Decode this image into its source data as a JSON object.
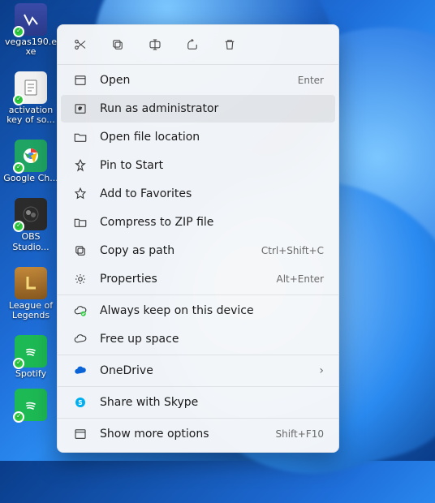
{
  "desktop": {
    "icons": [
      {
        "label": "vegas190.exe",
        "kind": "blue"
      },
      {
        "label": "activation key of so...",
        "kind": "white"
      },
      {
        "label": "Google Ch...",
        "kind": "green"
      },
      {
        "label": "OBS Studio...",
        "kind": "dark"
      },
      {
        "label": "League of Legends",
        "kind": "gold"
      },
      {
        "label": "Spotify",
        "kind": "spotify"
      }
    ]
  },
  "menu": {
    "toolbar": {
      "cut": "Cut",
      "copy": "Copy",
      "rename": "Rename",
      "share": "Share",
      "delete": "Delete"
    },
    "items": {
      "open": {
        "label": "Open",
        "accel": "Enter"
      },
      "run_admin": {
        "label": "Run as administrator"
      },
      "open_loc": {
        "label": "Open file location"
      },
      "pin_start": {
        "label": "Pin to Start"
      },
      "favorites": {
        "label": "Add to Favorites"
      },
      "compress": {
        "label": "Compress to ZIP file"
      },
      "copy_path": {
        "label": "Copy as path",
        "accel": "Ctrl+Shift+C"
      },
      "properties": {
        "label": "Properties",
        "accel": "Alt+Enter"
      },
      "always_keep": {
        "label": "Always keep on this device"
      },
      "free_space": {
        "label": "Free up space"
      },
      "onedrive": {
        "label": "OneDrive"
      },
      "skype": {
        "label": "Share with Skype"
      },
      "more": {
        "label": "Show more options",
        "accel": "Shift+F10"
      }
    }
  }
}
